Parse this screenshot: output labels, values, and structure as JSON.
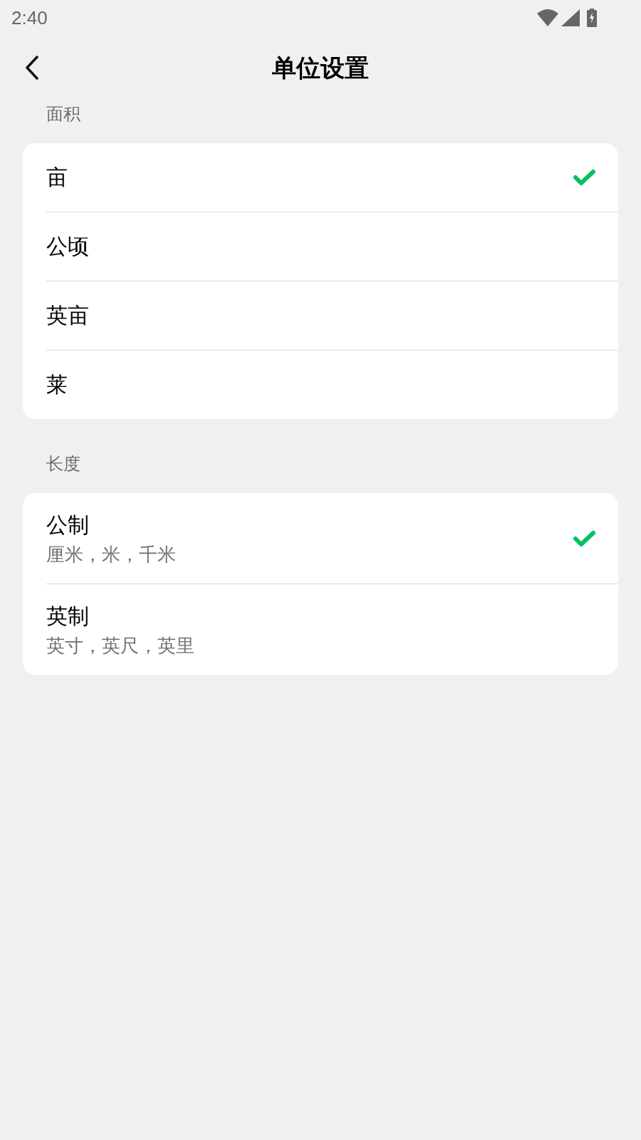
{
  "status_bar": {
    "time": "2:40"
  },
  "header": {
    "title": "单位设置"
  },
  "sections": [
    {
      "title": "面积",
      "options": [
        {
          "label": "亩",
          "selected": true
        },
        {
          "label": "公顷",
          "selected": false
        },
        {
          "label": "英亩",
          "selected": false
        },
        {
          "label": "莱",
          "selected": false
        }
      ]
    },
    {
      "title": "长度",
      "options": [
        {
          "label": "公制",
          "description": "厘米，米，千米",
          "selected": true
        },
        {
          "label": "英制",
          "description": "英寸，英尺，英里",
          "selected": false
        }
      ]
    }
  ]
}
